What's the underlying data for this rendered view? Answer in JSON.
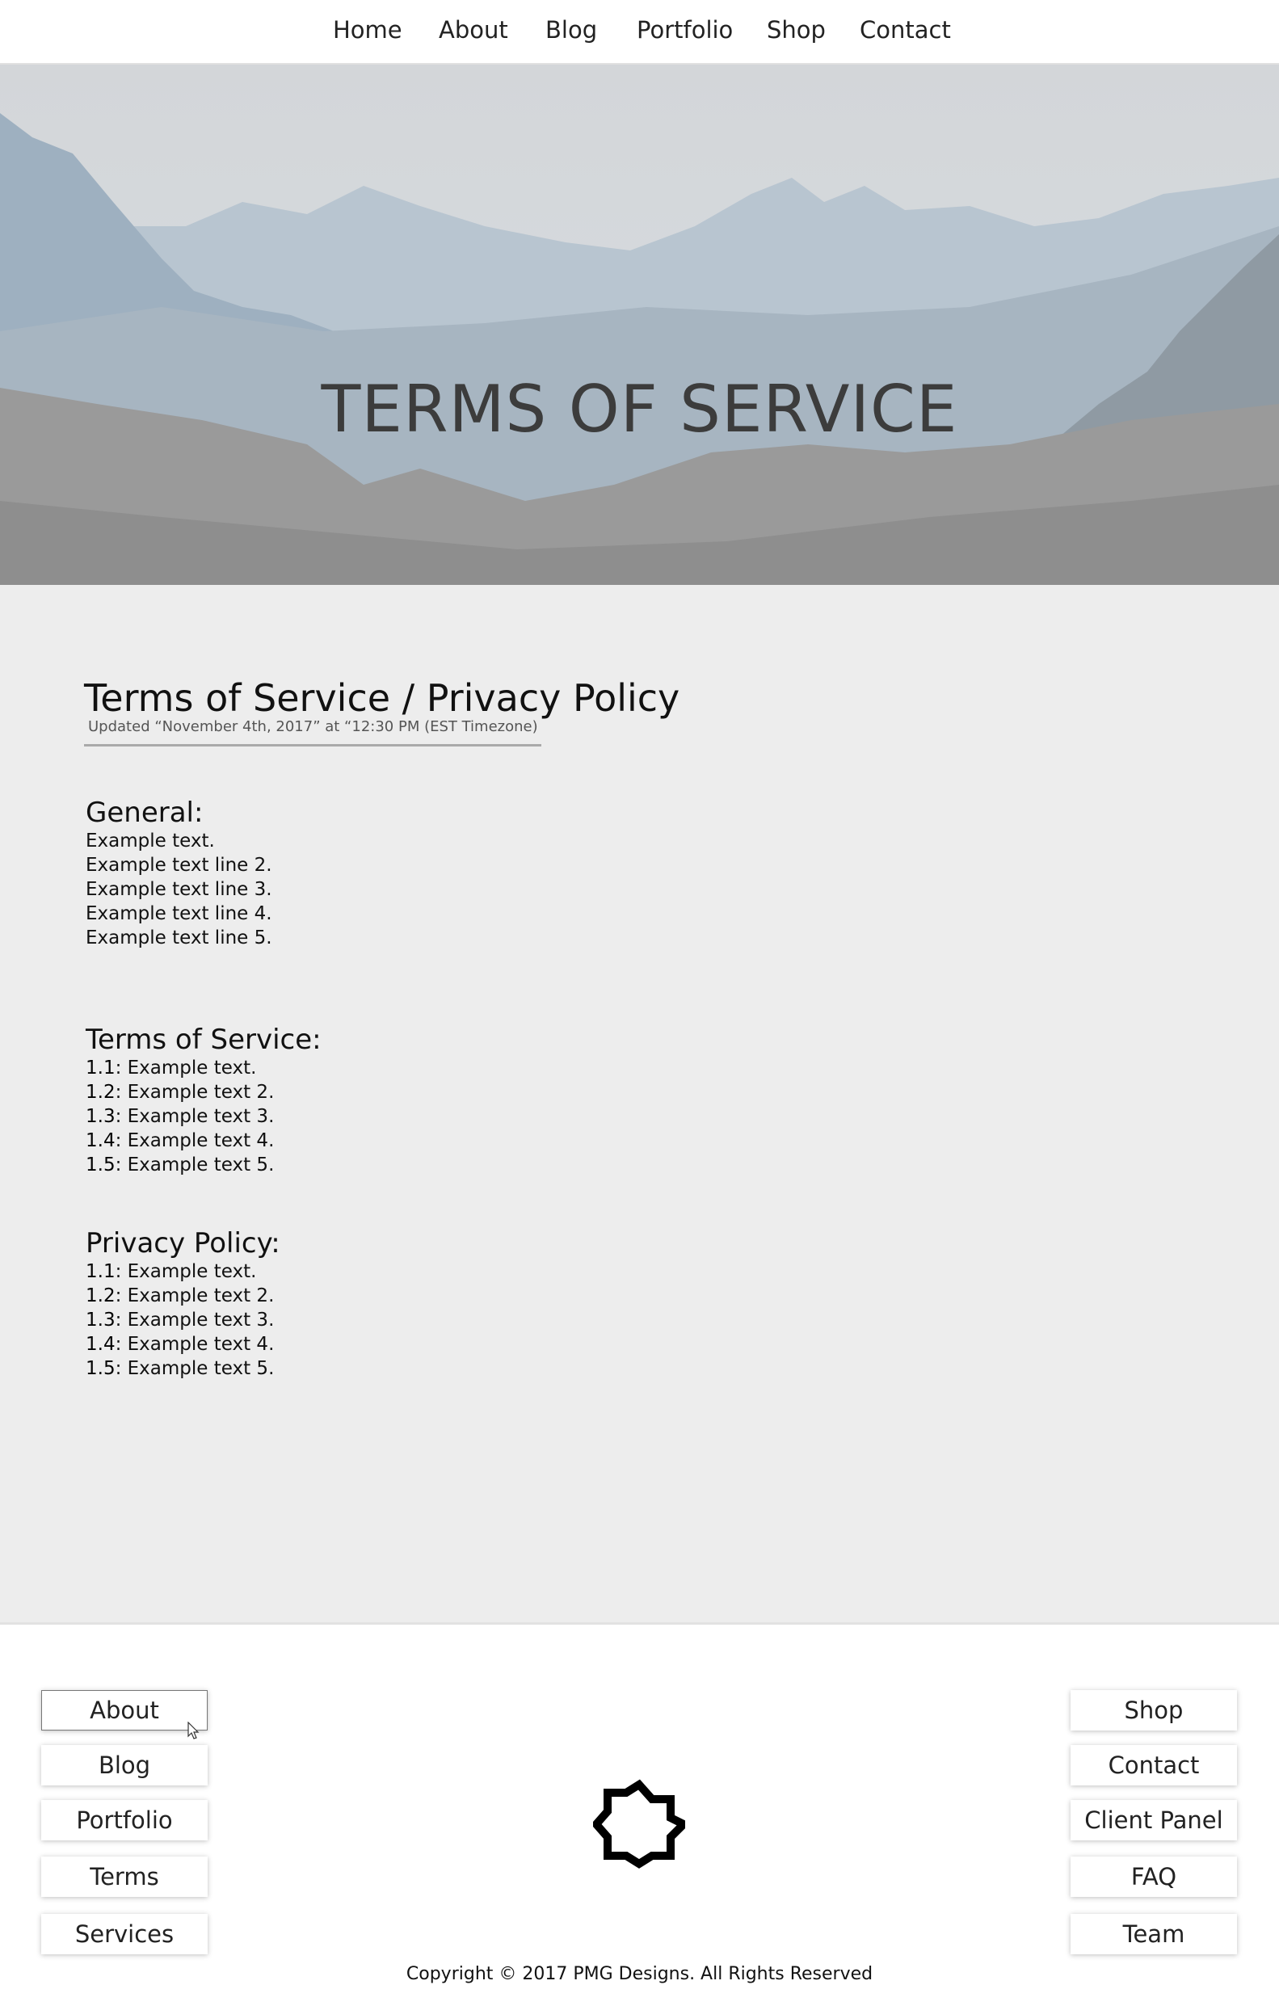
{
  "nav": {
    "items": [
      "Home",
      "About",
      "Blog",
      "Portfolio",
      "Shop",
      "Contact"
    ]
  },
  "hero": {
    "title": "TERMS OF SERVICE"
  },
  "document": {
    "title": "Terms of Service / Privacy Policy",
    "updated": "Updated “November 4th, 2017” at “12:30 PM (EST Timezone)",
    "sections": [
      {
        "heading": "General:",
        "lines": [
          "Example text.",
          "Example text line 2.",
          "Example text line 3.",
          "Example text line 4.",
          "Example text line 5."
        ]
      },
      {
        "heading": "Terms of Service:",
        "items": [
          {
            "num": "1.1",
            "text": ": Example text."
          },
          {
            "num": "1.2",
            "text": ": Example text 2."
          },
          {
            "num": "1.3",
            "text": ": Example text 3."
          },
          {
            "num": "1.4",
            "text": ": Example text 4."
          },
          {
            "num": "1.5",
            "text": ": Example text 5."
          }
        ]
      },
      {
        "heading": "Privacy Policy:",
        "items": [
          {
            "num": "1.1",
            "text": ": Example text."
          },
          {
            "num": "1.2",
            "text": ": Example text 2."
          },
          {
            "num": "1.3",
            "text": ": Example text 3."
          },
          {
            "num": "1.4",
            "text": ": Example text 4."
          },
          {
            "num": "1.5",
            "text": ": Example text 5."
          }
        ]
      }
    ]
  },
  "footer": {
    "left_links": [
      "About",
      "Blog",
      "Portfolio",
      "Terms",
      "Services"
    ],
    "right_links": [
      "Shop",
      "Contact",
      "Client Panel",
      "FAQ",
      "Team"
    ],
    "logo_icon": "star-outline-icon",
    "copyright": "Copyright © 2017 PMG Designs. All Rights Reserved"
  },
  "colors": {
    "nav_bg": "#ffffff",
    "content_bg": "#ededed",
    "footer_bg": "#ffffff",
    "hero_sky": "#d5dade",
    "hero_title": "#3c3c3c"
  }
}
